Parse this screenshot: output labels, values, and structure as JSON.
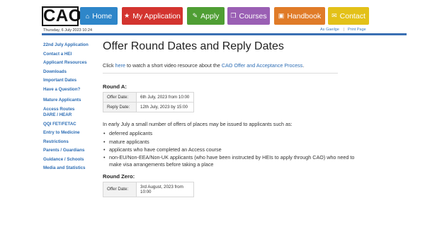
{
  "header": {
    "logo": "CAO",
    "date": "Thursday, 6 July 2023 10:24",
    "nav": [
      {
        "label": "Home",
        "icon": "home-icon",
        "color": "#2e86c9"
      },
      {
        "label": "My Application",
        "icon": "star-icon",
        "color": "#d3342f"
      },
      {
        "label": "Apply",
        "icon": "pencil-icon",
        "color": "#4f9e34"
      },
      {
        "label": "Courses",
        "icon": "book-icon",
        "color": "#9a5fb4"
      },
      {
        "label": "Handbook",
        "icon": "briefcase-icon",
        "color": "#e07b28"
      },
      {
        "label": "Contact",
        "icon": "chat-icon",
        "color": "#e3c118"
      }
    ],
    "as_gaeilge": "As Gaeilge",
    "separator": "|",
    "print_page": "Print Page"
  },
  "sidebar": {
    "items": [
      "22nd July Application",
      "Contact a HEI",
      "Applicant Resources",
      "Downloads",
      "Important Dates",
      "Have a Question?",
      "Mature Applicants",
      "Access Routes",
      "DARE / HEAR",
      "QQI FET/FETAC",
      "Entry to Medicine",
      "Restrictions",
      "Parents / Guardians",
      "Guidance / Schools",
      "Media and Statistics"
    ]
  },
  "main": {
    "title": "Offer Round Dates and Reply Dates",
    "intro_prefix": "Click ",
    "intro_link": "here",
    "intro_middle": " to watch a short video resource about the ",
    "intro_link2": "CAO Offer and Acceptance Process",
    "intro_suffix": ".",
    "round_a": {
      "heading": "Round A:",
      "rows": [
        {
          "label": "Offer Date:",
          "value": "6th July, 2023 from 10:00"
        },
        {
          "label": "Reply Date:",
          "value": "12th July, 2023 by 15:00"
        }
      ]
    },
    "paragraph": "In early July a small number of offers of places may be issued to applicants such as:",
    "bullets": [
      "deferred applicants",
      "mature applicants",
      "applicants who have completed an Access course",
      "non-EU/Non-EEA/Non-UK applicants (who have been instructed by HEIs to apply through CAO) who need to make visa arrangements before taking a place"
    ],
    "round_zero": {
      "heading": "Round Zero:",
      "rows": [
        {
          "label": "Offer Date:",
          "value": "3rd August, 2023 from 10:00"
        }
      ]
    }
  }
}
